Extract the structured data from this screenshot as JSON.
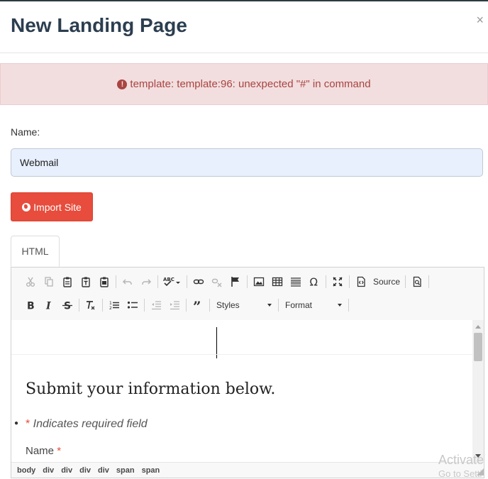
{
  "modal": {
    "title": "New Landing Page",
    "close": "×"
  },
  "alert": {
    "message": "template: template:96: unexpected \"#\" in command",
    "icon": "exclamation-circle-icon",
    "color": "#a94442"
  },
  "form": {
    "name_label": "Name:",
    "name_value": "Webmail",
    "import_label": "Import Site",
    "import_color": "#e74c3c"
  },
  "tabs": [
    {
      "label": "HTML"
    }
  ],
  "toolbar": {
    "source_label": "Source",
    "styles_label": "Styles",
    "format_label": "Format",
    "row1_icons": [
      "cut-icon",
      "copy-icon",
      "paste-icon",
      "paste-text-icon",
      "paste-from-word-icon",
      "undo-icon",
      "redo-icon",
      "spellcheck-icon",
      "link-icon",
      "unlink-icon",
      "anchor-icon",
      "image-icon",
      "table-icon",
      "horizontal-rule-icon",
      "special-character-icon",
      "maximize-icon",
      "source-icon",
      "preview-icon"
    ],
    "row2_icons": [
      "bold-icon",
      "italic-icon",
      "strikethrough-icon",
      "remove-format-icon",
      "numbered-list-icon",
      "bulleted-list-icon",
      "decrease-indent-icon",
      "increase-indent-icon",
      "blockquote-icon"
    ]
  },
  "content": {
    "heading": "Submit your information below.",
    "required_star": "*",
    "required_text": " Indicates required field",
    "name_field_label": "Name",
    "name_field_star": "*"
  },
  "statusbar": {
    "path": [
      "body",
      "div",
      "div",
      "div",
      "div",
      "span",
      "span"
    ]
  },
  "watermark": {
    "line1": "Activate",
    "line2": "Go to Setti"
  }
}
